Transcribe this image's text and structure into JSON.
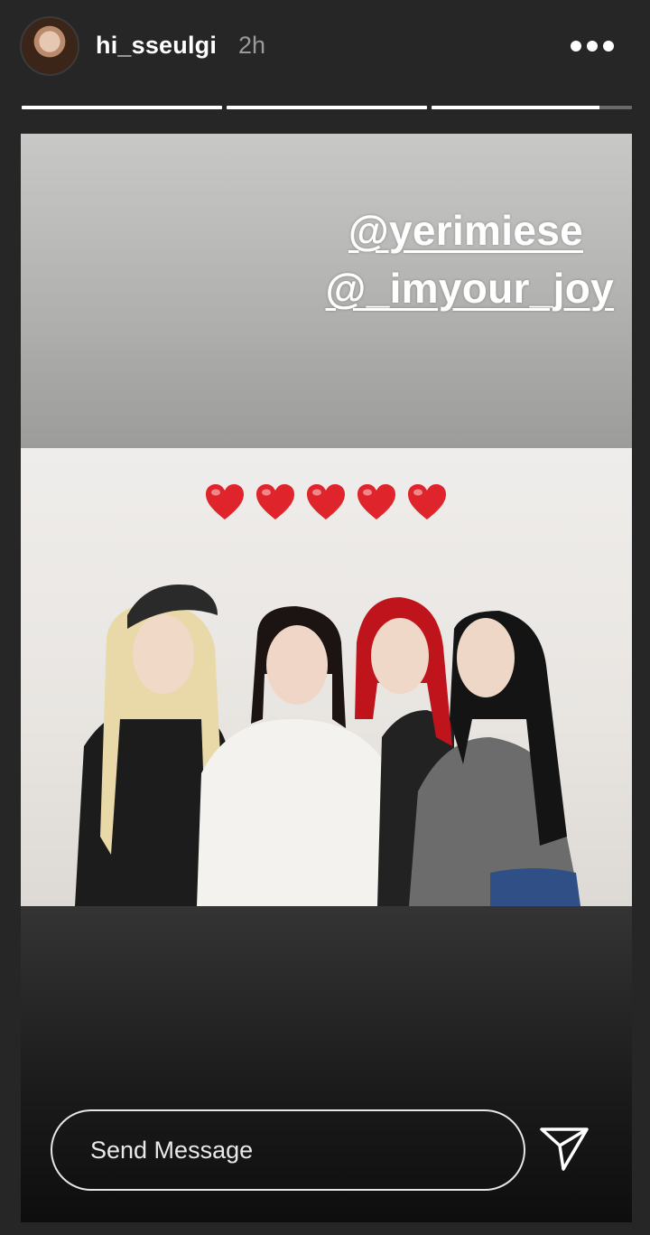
{
  "story": {
    "username": "hi_sseulgi",
    "time": "2h",
    "progress": [
      1.0,
      1.0,
      0.84
    ],
    "mentions": [
      "@yerimiese",
      "@_imyour_joy"
    ],
    "hearts_count": 5
  },
  "reply": {
    "placeholder": "Send Message"
  },
  "colors": {
    "background": "#262626",
    "heart": "#e0242b"
  }
}
